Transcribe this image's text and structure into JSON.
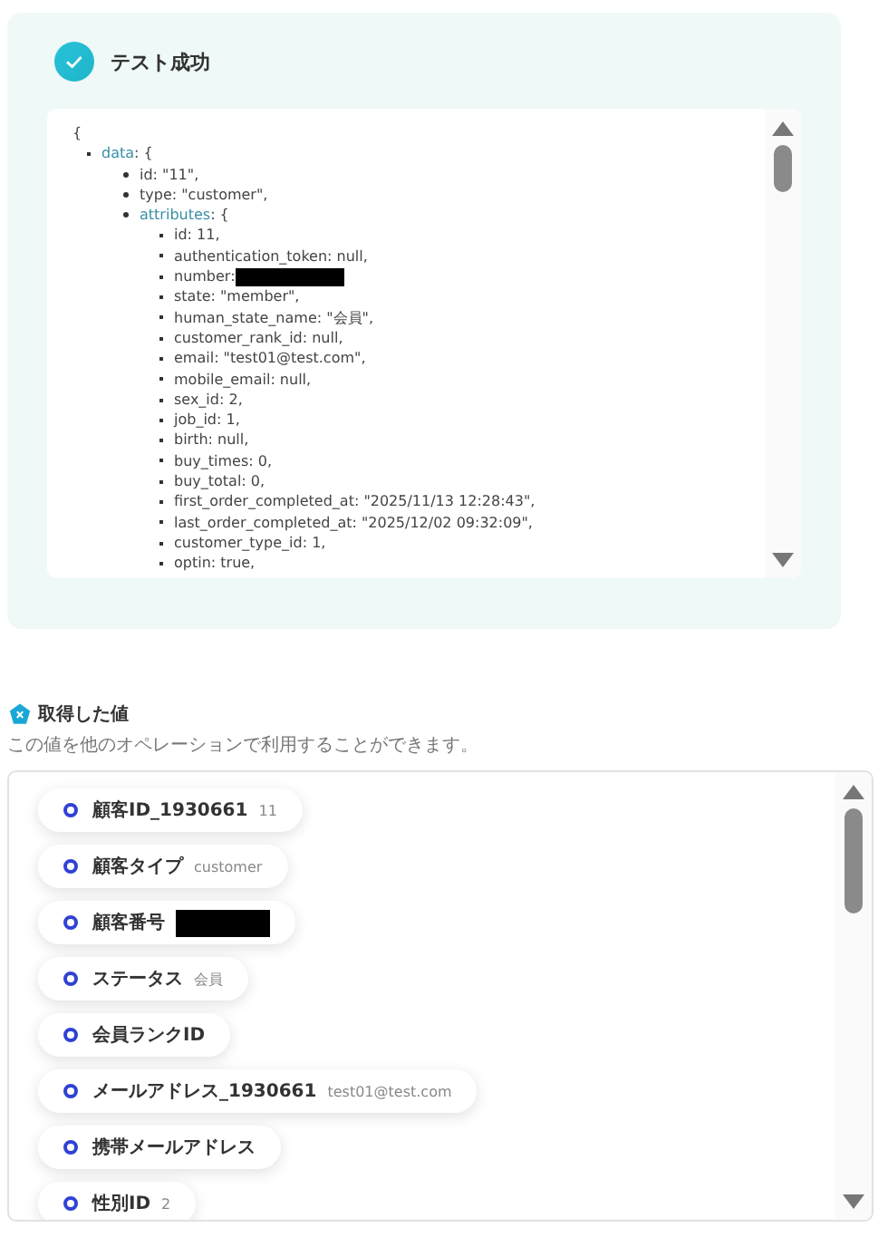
{
  "test_result": {
    "title": "テスト成功",
    "code": {
      "open": "{",
      "items": [
        {
          "key": "data",
          "text": ": {",
          "children": [
            {
              "text": "id: \"11\","
            },
            {
              "text": "type: \"customer\","
            },
            {
              "key": "attributes",
              "text": ": {",
              "children": [
                {
                  "text": "id: 11,"
                },
                {
                  "text": "authentication_token: null,"
                },
                {
                  "text": "number:",
                  "redacted": true
                },
                {
                  "text": "state: \"member\","
                },
                {
                  "text": "human_state_name: \"会員\","
                },
                {
                  "text": "customer_rank_id: null,"
                },
                {
                  "text": "email: \"test01@test.com\","
                },
                {
                  "text": "mobile_email: null,"
                },
                {
                  "text": "sex_id: 2,"
                },
                {
                  "text": "job_id: 1,"
                },
                {
                  "text": "birth: null,"
                },
                {
                  "text": "buy_times: 0,"
                },
                {
                  "text": "buy_total: 0,"
                },
                {
                  "text": "first_order_completed_at: \"2025/11/13 12:28:43\","
                },
                {
                  "text": "last_order_completed_at: \"2025/12/02 09:32:09\","
                },
                {
                  "text": "customer_type_id: 1,"
                },
                {
                  "text": "optin: true,"
                }
              ]
            }
          ]
        }
      ]
    }
  },
  "fetched_values": {
    "title": "取得した値",
    "description": "この値を他のオペレーションで利用することができます。",
    "items": [
      {
        "label": "顧客ID_1930661",
        "value": "11"
      },
      {
        "label": "顧客タイプ",
        "value": "customer"
      },
      {
        "label": "顧客番号",
        "redacted": true
      },
      {
        "label": "ステータス",
        "value": "会員"
      },
      {
        "label": "会員ランクID"
      },
      {
        "label": "メールアドレス_1930661",
        "value": "test01@test.com"
      },
      {
        "label": "携帯メールアドレス"
      },
      {
        "label": "性別ID",
        "value": "2"
      }
    ]
  }
}
